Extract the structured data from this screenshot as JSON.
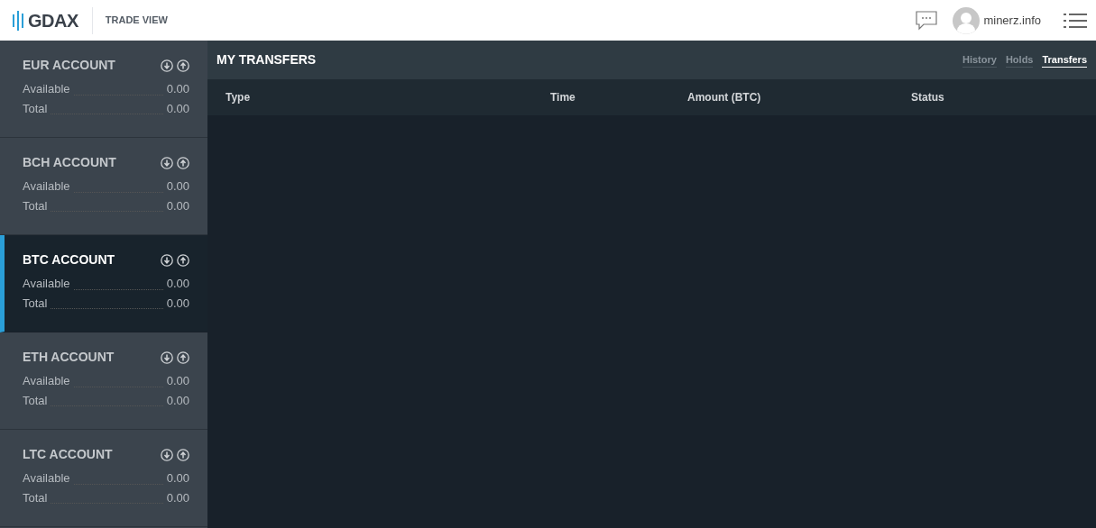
{
  "header": {
    "logo": "GDAX",
    "view": "TRADE VIEW",
    "user": "minerz.info"
  },
  "accounts": [
    {
      "name": "EUR ACCOUNT",
      "selected": false,
      "available": "0.00",
      "total": "0.00",
      "available_label": "Available",
      "total_label": "Total"
    },
    {
      "name": "BCH ACCOUNT",
      "selected": false,
      "available": "0.00",
      "total": "0.00",
      "available_label": "Available",
      "total_label": "Total"
    },
    {
      "name": "BTC ACCOUNT",
      "selected": true,
      "available": "0.00",
      "total": "0.00",
      "available_label": "Available",
      "total_label": "Total"
    },
    {
      "name": "ETH ACCOUNT",
      "selected": false,
      "available": "0.00",
      "total": "0.00",
      "available_label": "Available",
      "total_label": "Total"
    },
    {
      "name": "LTC ACCOUNT",
      "selected": false,
      "available": "0.00",
      "total": "0.00",
      "available_label": "Available",
      "total_label": "Total"
    }
  ],
  "panel": {
    "title": "MY TRANSFERS",
    "tabs": [
      {
        "label": "History",
        "selected": false
      },
      {
        "label": "Holds",
        "selected": false
      },
      {
        "label": "Transfers",
        "selected": true
      }
    ],
    "columns": [
      "Type",
      "Time",
      "Amount (BTC)",
      "Status"
    ]
  }
}
